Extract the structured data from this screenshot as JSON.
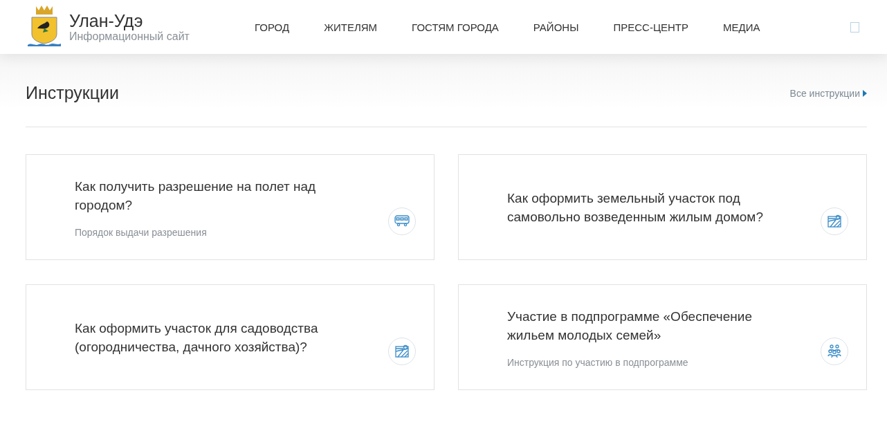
{
  "header": {
    "site_name": "Улан-Удэ",
    "site_subtitle": "Информационный сайт",
    "nav": [
      "ГОРОД",
      "ЖИТЕЛЯМ",
      "ГОСТЯМ ГОРОДА",
      "РАЙОНЫ",
      "ПРЕСС-ЦЕНТР",
      "МЕДИА"
    ]
  },
  "section": {
    "title": "Инструкции",
    "all_link": "Все инструкции"
  },
  "cards": [
    {
      "title": "Как получить разрешение на полет над городом?",
      "subtitle": "Порядок выдачи разрешения",
      "kind": "bus"
    },
    {
      "title": "Как оформить земельный участок под самовольно возведенным жилым домом?",
      "kind": "field"
    },
    {
      "title": "Как оформить участок для садоводства (огородничества, дачного хозяйства)?",
      "kind": "field"
    },
    {
      "title": "Участие в подпрограмме «Обеспечение жильем молодых семей»",
      "subtitle": "Инструкция по участию в подпрограмме",
      "kind": "people"
    }
  ]
}
